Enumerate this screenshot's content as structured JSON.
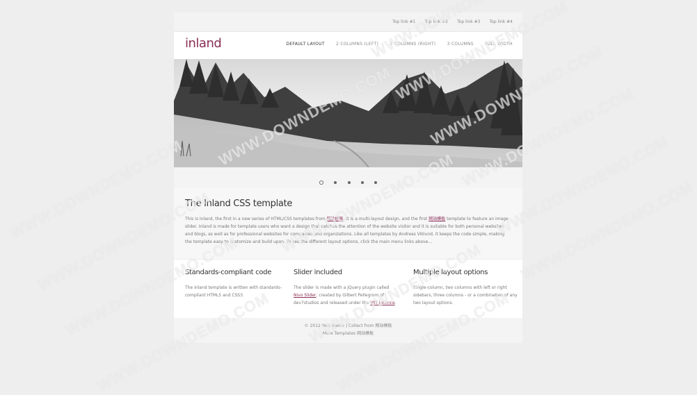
{
  "top_links": [
    "Top link #1",
    "Top link #2",
    "Top link #3",
    "Top link #4"
  ],
  "logo": "inland",
  "nav": [
    {
      "label": "DEFAULT LAYOUT",
      "active": true
    },
    {
      "label": "2 COLUMNS (LEFT)",
      "active": false
    },
    {
      "label": "2 COLUMNS (RIGHT)",
      "active": false
    },
    {
      "label": "3 COLUMNS",
      "active": false
    },
    {
      "label": "FULL WIDTH",
      "active": false
    }
  ],
  "slider": {
    "slide_count": 5,
    "active_index": 0
  },
  "intro": {
    "title": "The Inland CSS template",
    "p1": "This is Inland, the first in a new series of HTML/CSS templates from ",
    "link1": "网站模板",
    "p2": ". It is a multi-layout design, and the first ",
    "link2": "网站模板",
    "p3": " template to feature an image slider. Inland is made for template users who want a design that catches the attention of the website visitor and it is suitable for both personal websites and blogs, as well as for professional websites for companies and organizations. Like all templates by Andreas Viklund, it keeps the code simple, making the template easy to customize and build upon. To see the different layout options, click the main menu links above..."
  },
  "features": [
    {
      "title": "Standards-compliant code",
      "text": "The Inland template is written with standards-compliant HTML5 and CSS3."
    },
    {
      "title": "Slider included",
      "t1": "The slider is made with a jQuery plugin called ",
      "l1": "Nivo Slider",
      "t2": ", created by Gilbert Pellegrom of dev7studios and released under the ",
      "l2": "MIT Licence",
      "t3": "."
    },
    {
      "title": "Multiple layout options",
      "text": "Single-column, two columns with left or right sidebars, three columns - or a combination of any two layout options."
    }
  ],
  "footer": {
    "line1": "© 2012 Your Name | Collect from 网站模板",
    "line2": "More Templates 网站模板"
  },
  "watermark": "WWW.DOWNDEMO.COM",
  "colors": {
    "accent": "#8a2f55",
    "background": "#eeeeee"
  }
}
